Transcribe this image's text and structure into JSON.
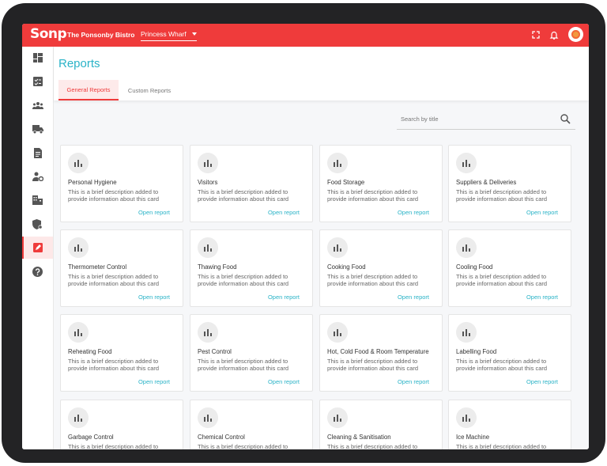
{
  "topbar": {
    "logo": "Sonp",
    "venue": "The Ponsonby Bistro",
    "location": "Princess Wharf"
  },
  "sidebar": {
    "items": [
      {
        "name": "dashboard",
        "icon": "dashboard-icon"
      },
      {
        "name": "checklist",
        "icon": "checklist-icon"
      },
      {
        "name": "team",
        "icon": "team-icon"
      },
      {
        "name": "deliveries",
        "icon": "truck-icon"
      },
      {
        "name": "documents",
        "icon": "document-icon"
      },
      {
        "name": "user-settings",
        "icon": "user-gear-icon"
      },
      {
        "name": "business",
        "icon": "building-icon"
      },
      {
        "name": "compliance",
        "icon": "shield-icon"
      },
      {
        "name": "reports",
        "icon": "report-icon",
        "active": true
      },
      {
        "name": "help",
        "icon": "help-icon"
      }
    ]
  },
  "page": {
    "title": "Reports",
    "tabs": [
      {
        "label": "General Reports",
        "active": true
      },
      {
        "label": "Custom Reports",
        "active": false
      }
    ],
    "search_placeholder": "Search by title"
  },
  "cards": {
    "description": "This is a brief description added to provide information about this card",
    "link": "Open report",
    "items": [
      {
        "title": "Personal Hygiene"
      },
      {
        "title": "Visitors"
      },
      {
        "title": "Food Storage"
      },
      {
        "title": "Suppliers & Deliveries"
      },
      {
        "title": "Thermometer Control"
      },
      {
        "title": "Thawing Food"
      },
      {
        "title": "Cooking Food"
      },
      {
        "title": "Cooling Food"
      },
      {
        "title": "Reheating Food"
      },
      {
        "title": "Pest Control"
      },
      {
        "title": "Hot, Cold Food & Room Temperature"
      },
      {
        "title": "Labelling Food"
      },
      {
        "title": "Garbage Control"
      },
      {
        "title": "Chemical Control"
      },
      {
        "title": "Cleaning & Sanitisation"
      },
      {
        "title": "Ice Machine"
      }
    ]
  },
  "colors": {
    "brand": "#ef3b3b",
    "accent": "#2ab3c7"
  }
}
